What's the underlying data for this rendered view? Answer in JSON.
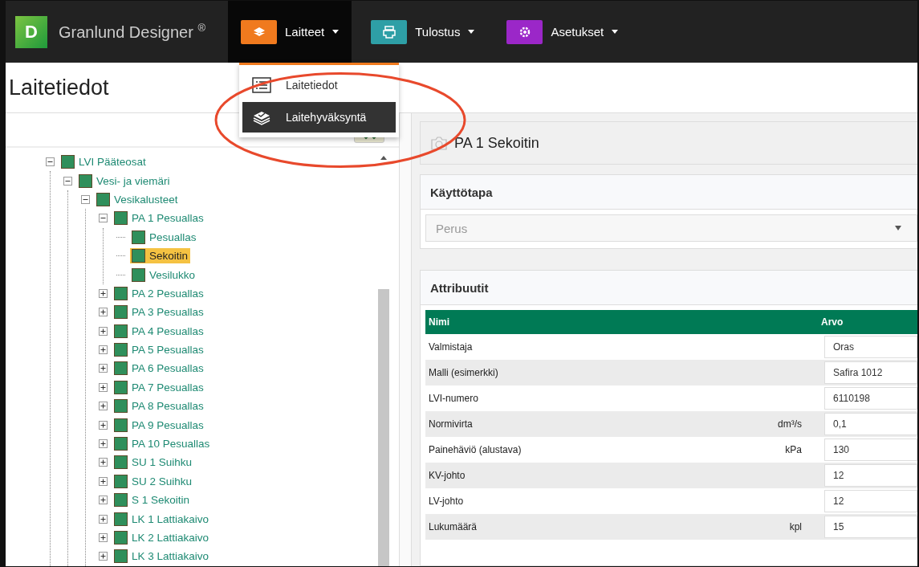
{
  "navbar": {
    "logo_letter": "D",
    "brand": "Granlund Designer $^{®}$",
    "items": [
      {
        "label": "Laitteet",
        "color": "#f07a1e",
        "selected": true
      },
      {
        "label": "Tulostus",
        "color": "#2e9fa6",
        "selected": false
      },
      {
        "label": "Asetukset",
        "color": "#9b27c8",
        "selected": false
      }
    ]
  },
  "dropdown": {
    "items": [
      {
        "label": "Laitetiedot",
        "kind": "list",
        "selected": false
      },
      {
        "label": "Laitehyväksyntä",
        "kind": "stack",
        "selected": true
      }
    ]
  },
  "page_title": "Laitetiedot",
  "tree": [
    {
      "label": "LVI Pääteosat",
      "expanded": true,
      "selected": false,
      "children": [
        {
          "label": "Vesi- ja viemäri",
          "expanded": true,
          "selected": false,
          "children": [
            {
              "label": "Vesikalusteet",
              "expanded": true,
              "selected": false,
              "children": [
                {
                  "label": "PA 1 Pesuallas",
                  "expanded": true,
                  "selected": false,
                  "children": [
                    {
                      "label": "Pesuallas",
                      "selected": false
                    },
                    {
                      "label": "Sekoitin",
                      "selected": true
                    },
                    {
                      "label": "Vesilukko",
                      "selected": false
                    }
                  ]
                },
                {
                  "label": "PA 2 Pesuallas",
                  "expanded": false,
                  "selected": false
                },
                {
                  "label": "PA 3 Pesuallas",
                  "expanded": false,
                  "selected": false
                },
                {
                  "label": "PA 4 Pesuallas",
                  "expanded": false,
                  "selected": false
                },
                {
                  "label": "PA 5 Pesuallas",
                  "expanded": false,
                  "selected": false
                },
                {
                  "label": "PA 6 Pesuallas",
                  "expanded": false,
                  "selected": false
                },
                {
                  "label": "PA 7 Pesuallas",
                  "expanded": false,
                  "selected": false
                },
                {
                  "label": "PA 8 Pesuallas",
                  "expanded": false,
                  "selected": false
                },
                {
                  "label": "PA 9 Pesuallas",
                  "expanded": false,
                  "selected": false
                },
                {
                  "label": "PA 10 Pesuallas",
                  "expanded": false,
                  "selected": false
                },
                {
                  "label": "SU 1 Suihku",
                  "expanded": false,
                  "selected": false
                },
                {
                  "label": "SU 2 Suihku",
                  "expanded": false,
                  "selected": false
                },
                {
                  "label": "S 1 Sekoitin",
                  "expanded": false,
                  "selected": false
                },
                {
                  "label": "LK 1 Lattiakaivo",
                  "expanded": false,
                  "selected": false
                },
                {
                  "label": "LK 2 Lattiakaivo",
                  "expanded": false,
                  "selected": false
                },
                {
                  "label": "LK 3 Lattiakaivo",
                  "expanded": false,
                  "selected": false
                }
              ]
            }
          ]
        }
      ]
    }
  ],
  "detail": {
    "title": "PA 1 Sekoitin",
    "usage": {
      "heading": "Käyttötapa",
      "select_value": "Perus"
    },
    "attributes": {
      "heading": "Attribuutit",
      "columns": [
        "Nimi",
        "Arvo"
      ],
      "rows": [
        {
          "name": "Valmistaja",
          "unit": "",
          "value": "Oras"
        },
        {
          "name": "Malli (esimerkki)",
          "unit": "",
          "value": "Safira 1012"
        },
        {
          "name": "LVI-numero",
          "unit": "",
          "value": "6110198"
        },
        {
          "name": "Normivirta",
          "unit": "dm³/s",
          "value": "0,1"
        },
        {
          "name": "Painehäviö (alustava)",
          "unit": "kPa",
          "value": "130"
        },
        {
          "name": "KV-johto",
          "unit": "",
          "value": "12"
        },
        {
          "name": "LV-johto",
          "unit": "",
          "value": "12"
        },
        {
          "name": "Lukumäärä",
          "unit": "kpl",
          "value": "15"
        }
      ]
    }
  }
}
